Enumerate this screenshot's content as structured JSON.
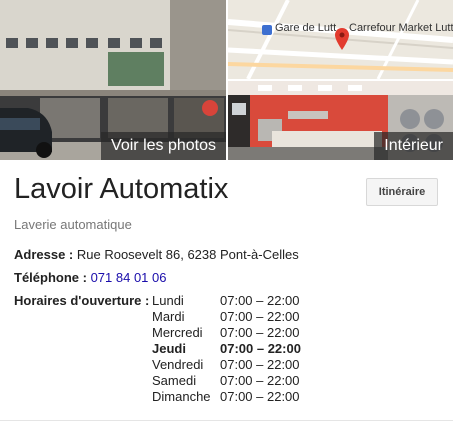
{
  "photos": {
    "main_label": "Voir les photos",
    "interior_label": "Intérieur",
    "map": {
      "station": "Gare de Lutt",
      "shop": "Carrefour Market Lutt"
    }
  },
  "place": {
    "name": "Lavoir Automatix",
    "category": "Laverie automatique",
    "route_button": "Itinéraire"
  },
  "address": {
    "label": "Adresse :",
    "value": "Rue Roosevelt 86, 6238 Pont-à-Celles"
  },
  "phone": {
    "label": "Téléphone :",
    "value": "071 84 01 06"
  },
  "hours": {
    "label": "Horaires d'ouverture :",
    "days": [
      {
        "day": "Lundi",
        "time": "07:00 – 22:00",
        "today": false
      },
      {
        "day": "Mardi",
        "time": "07:00 – 22:00",
        "today": false
      },
      {
        "day": "Mercredi",
        "time": "07:00 – 22:00",
        "today": false
      },
      {
        "day": "Jeudi",
        "time": "07:00 – 22:00",
        "today": true
      },
      {
        "day": "Vendredi",
        "time": "07:00 – 22:00",
        "today": false
      },
      {
        "day": "Samedi",
        "time": "07:00 – 22:00",
        "today": false
      },
      {
        "day": "Dimanche",
        "time": "07:00 – 22:00",
        "today": false
      }
    ]
  },
  "colors": {
    "link": "#1a0dab",
    "map_pin": "#e23b2e",
    "interior_wall": "#d84a3a"
  }
}
